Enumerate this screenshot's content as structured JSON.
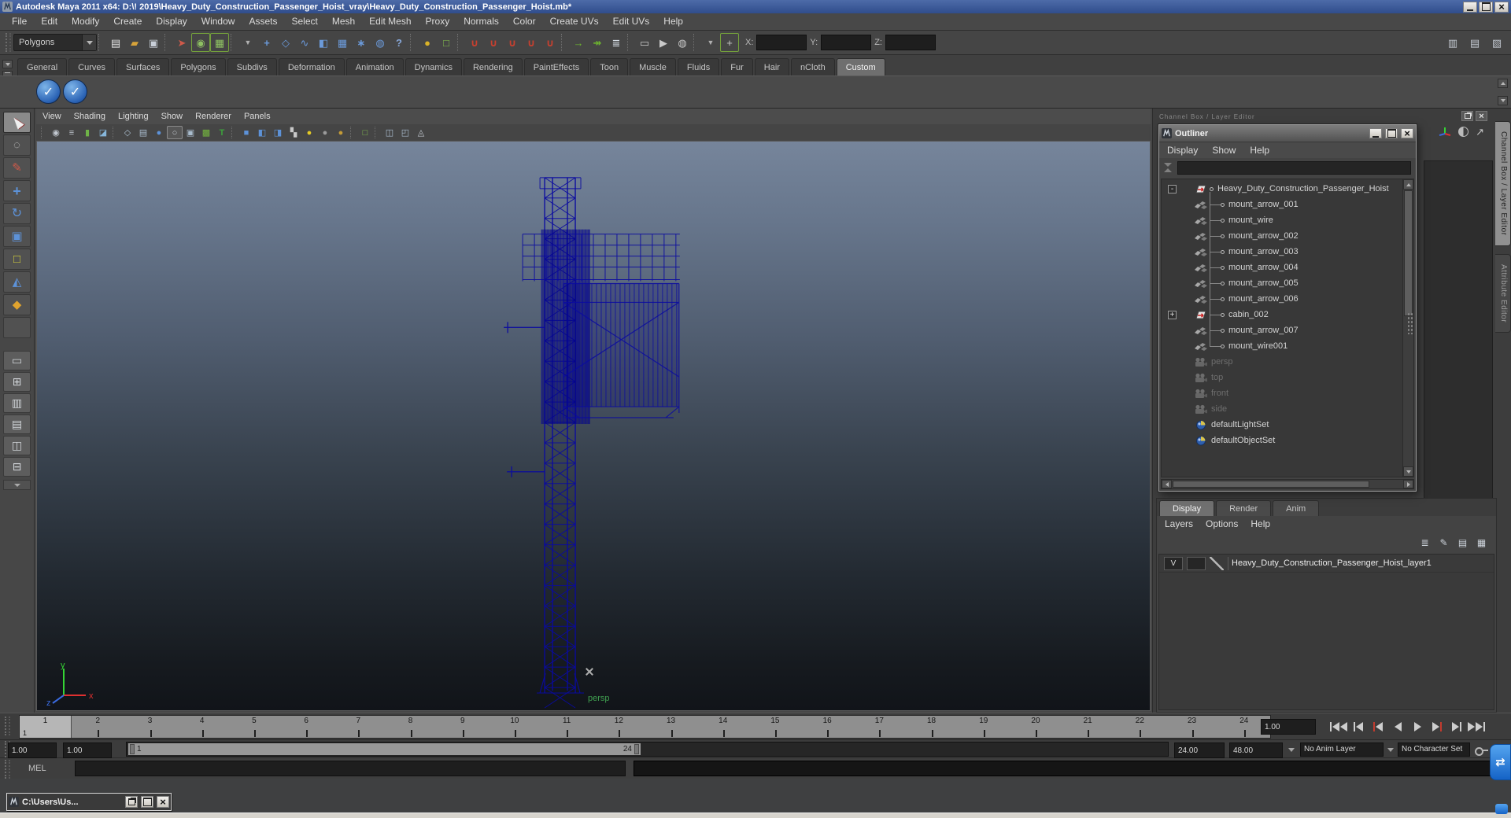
{
  "window": {
    "title": "Autodesk Maya 2011 x64: D:\\! 2019\\Heavy_Duty_Construction_Passenger_Hoist_vray\\Heavy_Duty_Construction_Passenger_Hoist.mb*"
  },
  "menu_bar": [
    "File",
    "Edit",
    "Modify",
    "Create",
    "Display",
    "Window",
    "Assets",
    "Select",
    "Mesh",
    "Edit Mesh",
    "Proxy",
    "Normals",
    "Color",
    "Create UVs",
    "Edit UVs",
    "Help"
  ],
  "status_line": {
    "mode_selector": "Polygons",
    "icons": [
      {
        "sep": true,
        "name": "separator"
      },
      {
        "name": "new-scene-icon",
        "glyph": "▤",
        "style": "color:#e4e4e4"
      },
      {
        "name": "open-scene-icon",
        "glyph": "▰",
        "style": "color:#d7a33a"
      },
      {
        "name": "save-scene-icon",
        "glyph": "▣",
        "style": "color:#c9cfd8"
      },
      {
        "sep": true,
        "name": "separator"
      },
      {
        "name": "selection-mask-mode-icon",
        "glyph": "➤",
        "style": "color:#cf5a4a"
      },
      {
        "name": "select-by-hierarchy-icon",
        "glyph": "◉",
        "style": "color:#8ec063",
        "frame": "true"
      },
      {
        "name": "select-by-object-icon",
        "glyph": "▦",
        "style": "color:#8ec063",
        "frame": "true"
      },
      {
        "sep": true,
        "name": "separator"
      },
      {
        "name": "selection-mask-dropdown-icon",
        "glyph": "▼",
        "style": "color:#b0b0b0;font-size:9px"
      },
      {
        "name": "select-handles-icon",
        "glyph": "+",
        "style": "color:#6b9ada;font-weight:bold"
      },
      {
        "name": "select-joints-icon",
        "glyph": "◇",
        "style": "color:#6b9ada"
      },
      {
        "name": "select-curves-icon",
        "glyph": "∿",
        "style": "color:#6b9ada"
      },
      {
        "name": "select-surfaces-icon",
        "glyph": "◧",
        "style": "color:#6b9ada"
      },
      {
        "name": "select-deformations-icon",
        "glyph": "▦",
        "style": "color:#6b9ada"
      },
      {
        "name": "select-dynamics-icon",
        "glyph": "∗",
        "style": "color:#6b9ada;font-weight:bold"
      },
      {
        "name": "select-rendering-icon",
        "glyph": "◍",
        "style": "color:#6b9ada"
      },
      {
        "name": "select-misc-icon",
        "glyph": "?",
        "style": "color:#87a7d8;font-weight:bold"
      },
      {
        "sep": true,
        "name": "separator"
      },
      {
        "name": "lock-selection-icon",
        "glyph": "●",
        "style": "color:#d9b228"
      },
      {
        "name": "highlight-selection-icon",
        "glyph": "□",
        "style": "color:#83c04e"
      },
      {
        "sep": true,
        "name": "separator"
      },
      {
        "name": "snap-to-grids-icon",
        "glyph": "∪",
        "style": "color:#c8402f;font-weight:bold"
      },
      {
        "name": "snap-to-curves-icon",
        "glyph": "∪",
        "style": "color:#c8402f;font-weight:bold"
      },
      {
        "name": "snap-to-points-icon",
        "glyph": "∪",
        "style": "color:#c8402f;font-weight:bold"
      },
      {
        "name": "snap-to-view-planes-icon",
        "glyph": "∪",
        "style": "color:#c8402f;font-weight:bold"
      },
      {
        "name": "make-object-live-icon",
        "glyph": "∪",
        "style": "color:#c8402f;font-weight:bold"
      },
      {
        "sep": true,
        "name": "separator"
      },
      {
        "name": "input-connections-icon",
        "glyph": "→",
        "style": "color:#6db52f;font-weight:bold"
      },
      {
        "name": "output-connections-icon",
        "glyph": "↠",
        "style": "color:#6db52f;font-weight:bold"
      },
      {
        "name": "construction-history-icon",
        "glyph": "≣",
        "style": "color:#d3dae2"
      },
      {
        "sep": true,
        "name": "separator"
      },
      {
        "name": "render-view-icon",
        "glyph": "▭",
        "style": "color:#c9c9c9"
      },
      {
        "name": "render-current-frame-icon",
        "glyph": "▶",
        "style": "color:#c9c9c9"
      },
      {
        "name": "ipr-render-icon",
        "glyph": "◍",
        "style": "color:#c9c9c9"
      },
      {
        "sep": true,
        "name": "separator"
      }
    ],
    "transform_icons": [
      {
        "name": "transform-dropdown-icon",
        "glyph": "▼",
        "style": "color:#b0b0b0;font-size:9px"
      },
      {
        "name": "absolute-transform-icon",
        "glyph": "+",
        "style": "color:#c9c9c9",
        "frame": "true"
      }
    ],
    "coord_fields": {
      "x_label": "X:",
      "x_value": "",
      "y_label": "Y:",
      "y_value": "",
      "z_label": "Z:",
      "z_value": ""
    },
    "right_icons": [
      {
        "name": "show-channel-box-icon",
        "glyph": "▥",
        "style": "color:#c2c8d0"
      },
      {
        "name": "show-tool-settings-icon",
        "glyph": "▤",
        "style": "color:#c2c8d0"
      },
      {
        "name": "show-attribute-editor-icon",
        "glyph": "▧",
        "style": "color:#c2c8d0"
      }
    ]
  },
  "shelf": {
    "tabs": [
      {
        "label": "General"
      },
      {
        "label": "Curves"
      },
      {
        "label": "Surfaces"
      },
      {
        "label": "Polygons"
      },
      {
        "label": "Subdivs"
      },
      {
        "label": "Deformation"
      },
      {
        "label": "Animation"
      },
      {
        "label": "Dynamics"
      },
      {
        "label": "Rendering"
      },
      {
        "label": "PaintEffects"
      },
      {
        "label": "Toon"
      },
      {
        "label": "Muscle"
      },
      {
        "label": "Fluids"
      },
      {
        "label": "Fur"
      },
      {
        "label": "Hair"
      },
      {
        "label": "nCloth"
      },
      {
        "label": "Custom",
        "active": "true"
      }
    ],
    "buttons": [
      {
        "name": "custom-shelf-check-button-1",
        "glyph": "✓"
      },
      {
        "name": "custom-shelf-check-button-2",
        "glyph": "✓"
      }
    ]
  },
  "toolbox": {
    "tools": [
      {
        "name": "select-tool",
        "glyph": "",
        "style": "",
        "active": "true"
      },
      {
        "name": "lasso-select-tool",
        "glyph": "◌",
        "style": "color:#d0d0d0"
      },
      {
        "name": "paint-select-tool",
        "glyph": "✎",
        "style": "color:#cf5a4a"
      },
      {
        "name": "move-tool",
        "glyph": "+",
        "style": "color:#5d92d8;font-weight:bold;font-size:18px"
      },
      {
        "name": "rotate-tool",
        "glyph": "↻",
        "style": "color:#5d92d8;font-size:16px"
      },
      {
        "name": "scale-tool",
        "glyph": "▣",
        "style": "color:#5d92d8"
      },
      {
        "name": "universal-manipulator-tool",
        "glyph": "□",
        "style": "color:#d8d43a"
      },
      {
        "name": "soft-modification-tool",
        "glyph": "◭",
        "style": "color:#5d92d8"
      },
      {
        "name": "show-manipulator-tool",
        "glyph": "◆",
        "style": "color:#e0a32e"
      },
      {
        "name": "last-tool",
        "glyph": "",
        "style": ""
      }
    ],
    "layouts": [
      {
        "name": "single-pane-layout-icon",
        "glyph": "▭"
      },
      {
        "name": "four-pane-layout-icon",
        "glyph": "⊞"
      },
      {
        "name": "outliner-persp-layout-icon",
        "glyph": "▥"
      },
      {
        "name": "graph-persp-layout-icon",
        "glyph": "▤"
      },
      {
        "name": "hypergraph-persp-layout-icon",
        "glyph": "◫"
      },
      {
        "name": "persp-graph-layout-icon",
        "glyph": "⊟"
      }
    ]
  },
  "viewport": {
    "menus": [
      "View",
      "Shading",
      "Lighting",
      "Show",
      "Renderer",
      "Panels"
    ],
    "icons": [
      {
        "sep": true,
        "name": "separator"
      },
      {
        "name": "select-camera-icon",
        "glyph": "◉",
        "style": "color:#c2c8d0"
      },
      {
        "name": "camera-attributes-icon",
        "glyph": "≡",
        "style": "color:#c2c8d0"
      },
      {
        "name": "bookmarks-icon",
        "glyph": "▮",
        "style": "color:#6fb347"
      },
      {
        "name": "image-plane-icon",
        "glyph": "◪",
        "style": "color:#86b6da"
      },
      {
        "sep": true,
        "name": "separator"
      },
      {
        "name": "wireframe-mode-icon",
        "glyph": "◇",
        "style": "color:#a9bccd"
      },
      {
        "name": "film-gate-icon",
        "glyph": "▤",
        "style": "color:#a9bccd"
      },
      {
        "name": "shaded-mode-icon",
        "glyph": "●",
        "style": "color:#5d92d8"
      },
      {
        "name": "flat-shaded-icon",
        "glyph": "○",
        "style": "color:#c6ccd3",
        "frame": "true"
      },
      {
        "name": "bounding-box-icon",
        "glyph": "▣",
        "style": "color:#a9bccd"
      },
      {
        "name": "textured-mode-icon",
        "glyph": "▩",
        "style": "color:#74b53e"
      },
      {
        "name": "texture-placement-icon",
        "glyph": "T",
        "style": "color:#3da23d;font-weight:bold"
      },
      {
        "sep": true,
        "name": "separator"
      },
      {
        "name": "default-material-icon",
        "glyph": "■",
        "style": "color:#5d92d8"
      },
      {
        "name": "shaded-cube-icon",
        "glyph": "◧",
        "style": "color:#5d92d8"
      },
      {
        "name": "textured-cube-icon",
        "glyph": "◨",
        "style": "color:#5d92d8"
      },
      {
        "name": "checkered-icon",
        "glyph": "▚",
        "style": "color:#c9c9c9"
      },
      {
        "name": "all-lights-icon",
        "glyph": "●",
        "style": "color:#e5cb25"
      },
      {
        "name": "no-lights-icon",
        "glyph": "●",
        "style": "color:#9b9b9b"
      },
      {
        "name": "default-light-icon",
        "glyph": "●",
        "style": "color:#c49b37"
      },
      {
        "sep": true,
        "name": "separator"
      },
      {
        "name": "isolate-select-icon",
        "glyph": "□",
        "style": "color:#83c04e"
      },
      {
        "sep": true,
        "name": "separator"
      },
      {
        "name": "xray-icon",
        "glyph": "◫",
        "style": "color:#a9bccd"
      },
      {
        "name": "xray-active-icon",
        "glyph": "◰",
        "style": "color:#a9bccd"
      },
      {
        "name": "share-node-icon",
        "glyph": "◬",
        "style": "color:#c2c8d0"
      }
    ],
    "camera_label": "persp",
    "axis": {
      "x": "x",
      "y": "y",
      "z": "z"
    }
  },
  "dock": {
    "header": "Channel Box / Layer Editor",
    "tabs": [
      {
        "label": "Channel Box / Layer Editor",
        "active": "true"
      },
      {
        "label": "Attribute Editor"
      }
    ]
  },
  "outliner": {
    "title": "Outliner",
    "menus": [
      "Display",
      "Show",
      "Help"
    ],
    "search_value": "",
    "items": [
      {
        "label": "Heavy_Duty_Construction_Passenger_Hoist",
        "icon": "mesh",
        "depth": 0,
        "expander": "-",
        "bullet": "true"
      },
      {
        "label": "mount_arrow_001",
        "icon": "poly",
        "depth": 1,
        "bullet": "true"
      },
      {
        "label": "mount_wire",
        "icon": "poly",
        "depth": 1,
        "bullet": "true"
      },
      {
        "label": "mount_arrow_002",
        "icon": "poly",
        "depth": 1,
        "bullet": "true"
      },
      {
        "label": "mount_arrow_003",
        "icon": "poly",
        "depth": 1,
        "bullet": "true"
      },
      {
        "label": "mount_arrow_004",
        "icon": "poly",
        "depth": 1,
        "bullet": "true"
      },
      {
        "label": "mount_arrow_005",
        "icon": "poly",
        "depth": 1,
        "bullet": "true"
      },
      {
        "label": "mount_arrow_006",
        "icon": "poly",
        "depth": 1,
        "bullet": "true"
      },
      {
        "label": "cabin_002",
        "icon": "mesh",
        "depth": 1,
        "expander": "+",
        "bullet": "true"
      },
      {
        "label": "mount_arrow_007",
        "icon": "poly",
        "depth": 1,
        "bullet": "true"
      },
      {
        "label": "mount_wire001",
        "icon": "poly",
        "depth": 1,
        "bullet": "true"
      },
      {
        "label": "persp",
        "icon": "camera",
        "depth": 0,
        "muted": "true"
      },
      {
        "label": "top",
        "icon": "camera",
        "depth": 0,
        "muted": "true"
      },
      {
        "label": "front",
        "icon": "camera",
        "depth": 0,
        "muted": "true"
      },
      {
        "label": "side",
        "icon": "camera",
        "depth": 0,
        "muted": "true"
      },
      {
        "label": "defaultLightSet",
        "icon": "set",
        "depth": 0
      },
      {
        "label": "defaultObjectSet",
        "icon": "set",
        "depth": 0
      }
    ]
  },
  "layer_editor": {
    "tabs": [
      {
        "label": "Display",
        "active": "true"
      },
      {
        "label": "Render"
      },
      {
        "label": "Anim"
      }
    ],
    "menus": [
      "Layers",
      "Options",
      "Help"
    ],
    "icons": [
      {
        "name": "layer-sort-icon",
        "glyph": "≣"
      },
      {
        "name": "layer-edit-icon",
        "glyph": "✎"
      },
      {
        "name": "new-empty-layer-icon",
        "glyph": "▤"
      },
      {
        "name": "new-layer-from-selected-icon",
        "glyph": "▦"
      }
    ],
    "rows": [
      {
        "visibility": "V",
        "name": "Heavy_Duty_Construction_Passenger_Hoist_layer1"
      }
    ]
  },
  "timeline": {
    "frames": [
      "1",
      "2",
      "3",
      "4",
      "5",
      "6",
      "7",
      "8",
      "9",
      "10",
      "11",
      "12",
      "13",
      "14",
      "15",
      "16",
      "17",
      "18",
      "19",
      "20",
      "21",
      "22",
      "23",
      "24"
    ],
    "current_frame": "1",
    "current_time": "1.00"
  },
  "range_slider": {
    "anim_start": "1.00",
    "playback_start": "1.00",
    "bar_start_label": "1",
    "bar_end_label": "24",
    "playback_end": "24.00",
    "anim_end": "48.00",
    "anim_layer": "No Anim Layer",
    "character_set": "No Character Set"
  },
  "command_line": {
    "label": "MEL",
    "input_value": "",
    "output_value": ""
  },
  "taskbar": {
    "minimized_title": "C:\\Users\\Us..."
  },
  "colors": {
    "wireframe": "#0a0aa0",
    "viewport_top": "#76859b",
    "viewport_bottom": "#111419",
    "titlebar": "#3a589e",
    "persp_label": "#3f9e4f",
    "shelf_button_blue": "#2a62b4"
  }
}
